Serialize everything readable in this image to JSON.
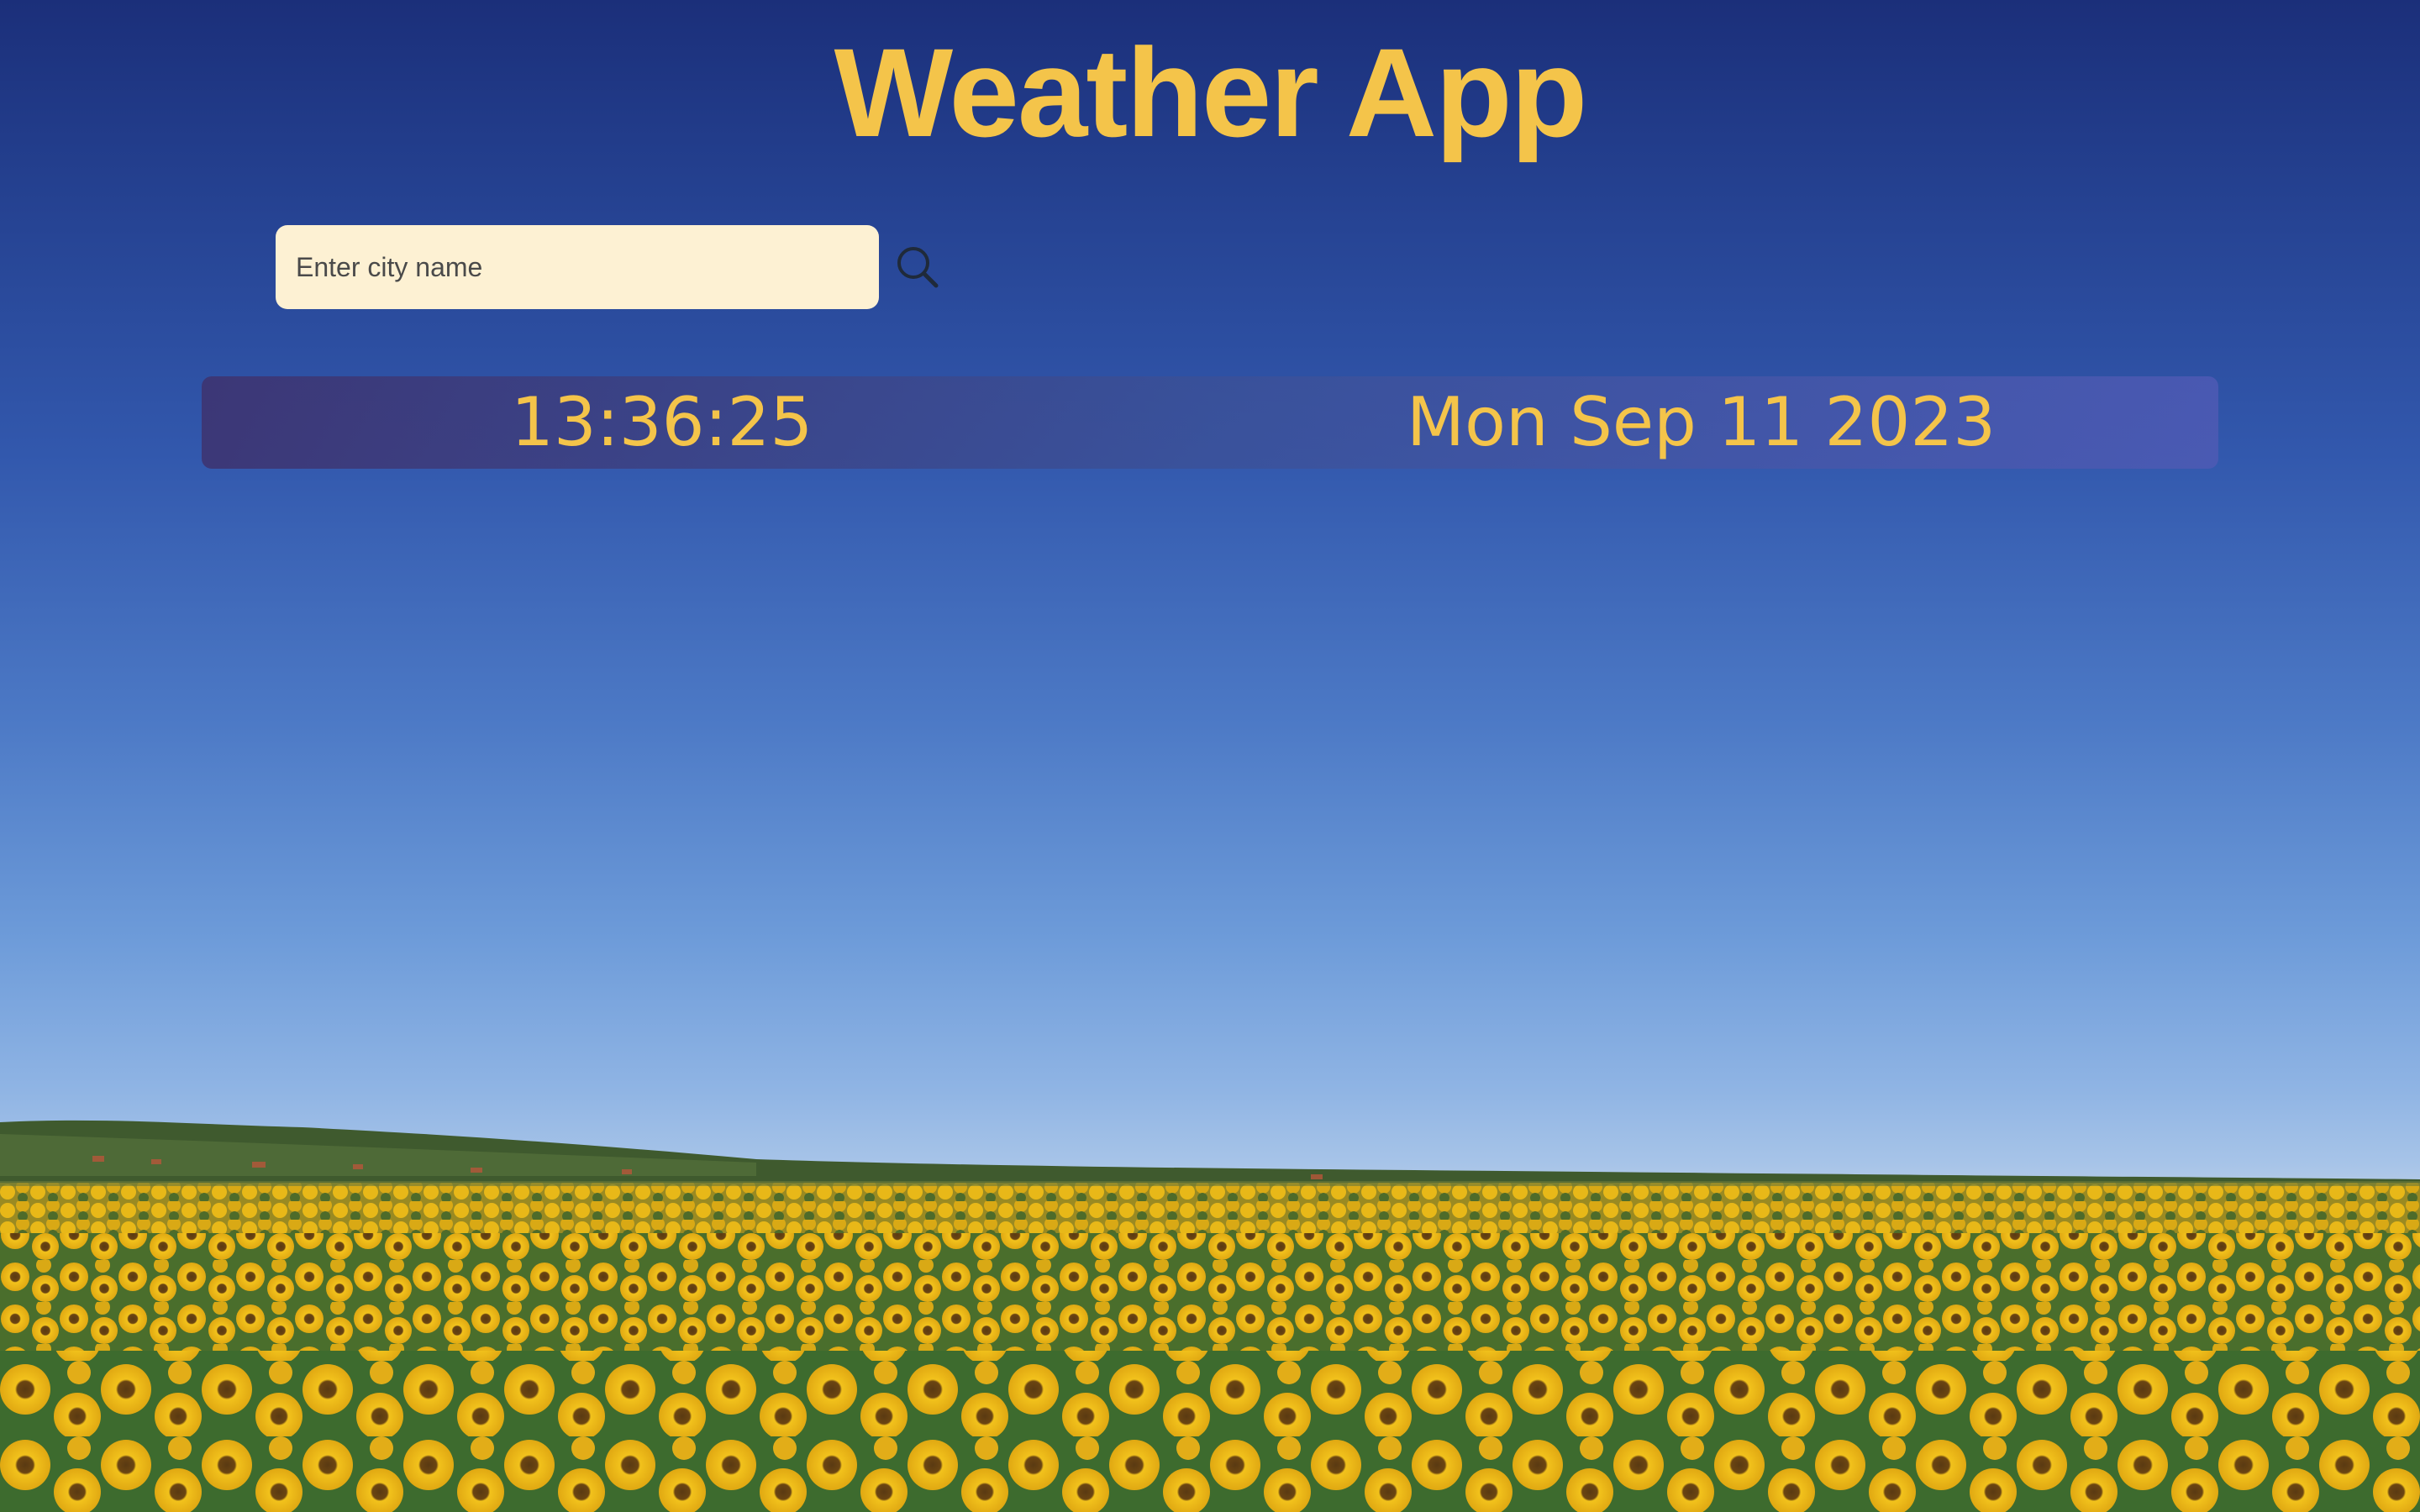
{
  "app": {
    "title": "Weather App"
  },
  "search": {
    "placeholder": "Enter city name",
    "value": "",
    "button_icon": "search-icon"
  },
  "datetime": {
    "time": "13:36:25",
    "date": "Mon Sep 11 2023"
  },
  "colors": {
    "title": "#f4c44a",
    "input_background": "#fdf1d3",
    "bar_text": "#f4c44a",
    "sky_top": "#1b2f7a",
    "sky_horizon": "#b8cce6",
    "sunflower": "#f0c020",
    "foliage": "#3d6b2e"
  },
  "background": {
    "scene": "sunflower-field-under-blue-sky"
  }
}
